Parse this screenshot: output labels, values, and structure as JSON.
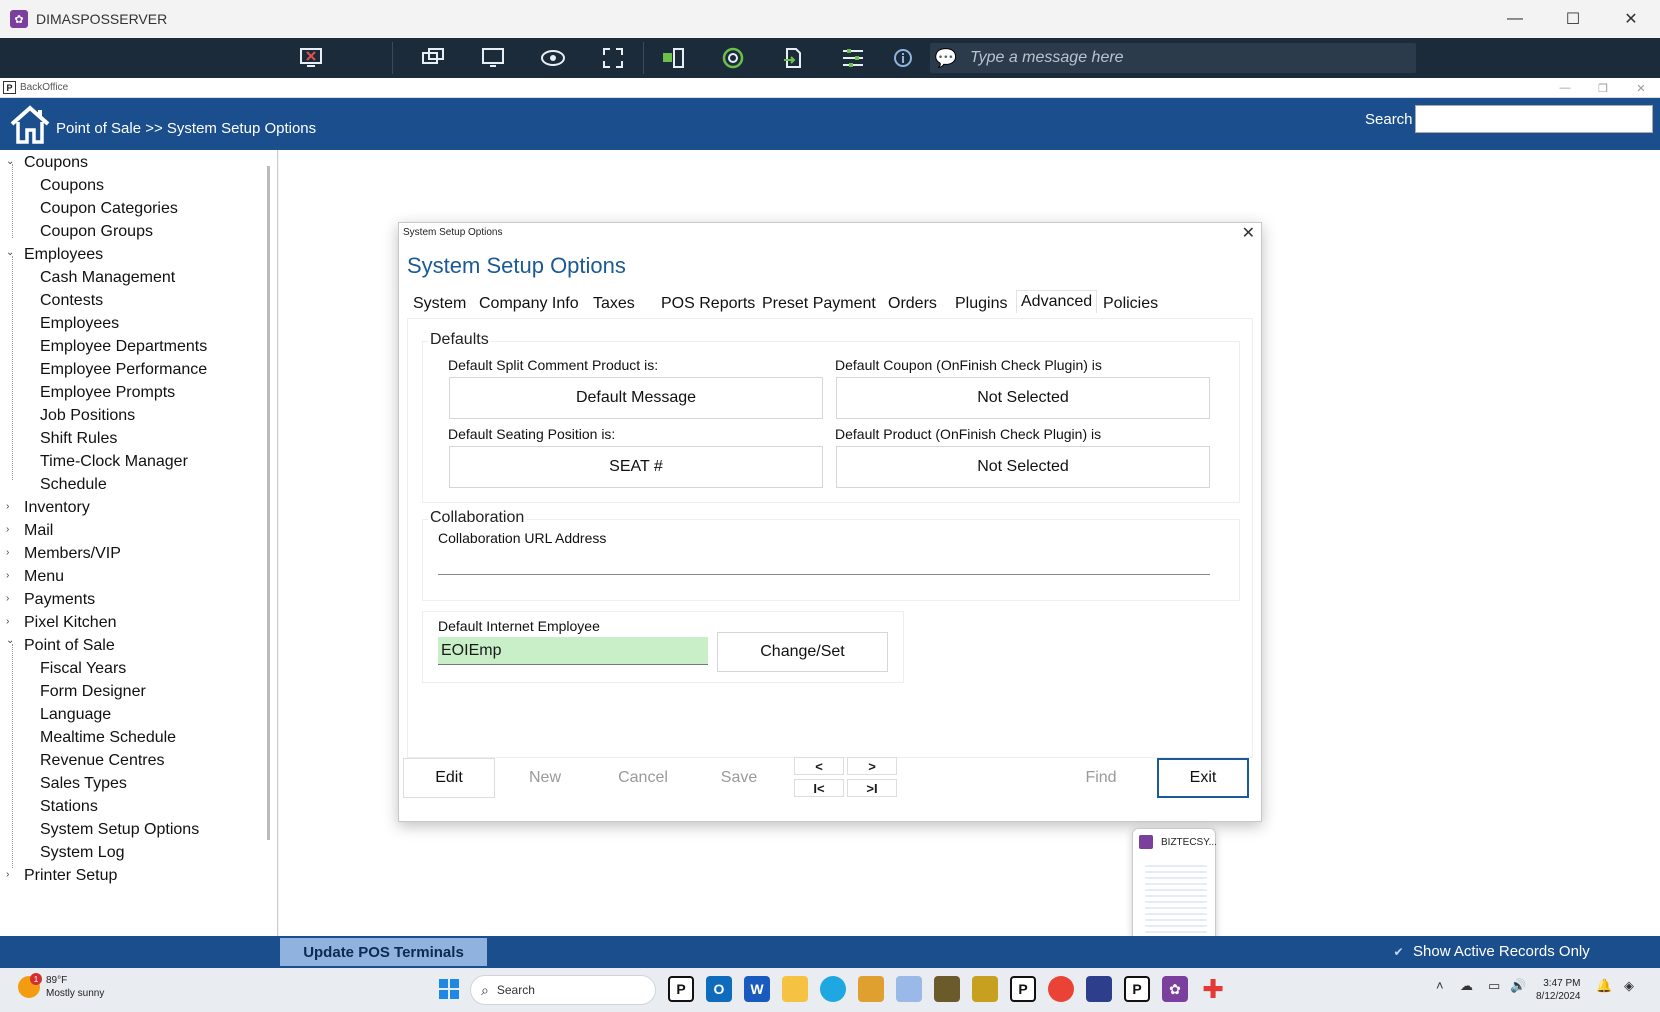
{
  "window": {
    "title": "DIMASPOSSERVER",
    "minimize": "—",
    "maximize": "☐",
    "close": "✕"
  },
  "remote_toolbar": {
    "message_placeholder": "Type a message here"
  },
  "backoffice": {
    "title": "BackOffice"
  },
  "header": {
    "breadcrumb": "Point of Sale >> System Setup Options",
    "search_label": "Search",
    "search_value": ""
  },
  "sidebar": {
    "items": [
      {
        "label": "Coupons",
        "level": 0,
        "expanded": true
      },
      {
        "label": "Coupons",
        "level": 1
      },
      {
        "label": "Coupon Categories",
        "level": 1
      },
      {
        "label": "Coupon Groups",
        "level": 1
      },
      {
        "label": "Employees",
        "level": 0,
        "expanded": true
      },
      {
        "label": "Cash Management",
        "level": 1
      },
      {
        "label": "Contests",
        "level": 1
      },
      {
        "label": "Employees",
        "level": 1
      },
      {
        "label": "Employee Departments",
        "level": 1
      },
      {
        "label": "Employee Performance",
        "level": 1
      },
      {
        "label": "Employee Prompts",
        "level": 1
      },
      {
        "label": "Job Positions",
        "level": 1
      },
      {
        "label": "Shift Rules",
        "level": 1
      },
      {
        "label": "Time-Clock Manager",
        "level": 1
      },
      {
        "label": "Schedule",
        "level": 1
      },
      {
        "label": "Inventory",
        "level": 0,
        "expanded": false
      },
      {
        "label": "Mail",
        "level": 0,
        "expanded": false
      },
      {
        "label": "Members/VIP",
        "level": 0,
        "expanded": false
      },
      {
        "label": "Menu",
        "level": 0,
        "expanded": false
      },
      {
        "label": "Payments",
        "level": 0,
        "expanded": false
      },
      {
        "label": "Pixel Kitchen",
        "level": 0,
        "expanded": false
      },
      {
        "label": "Point of Sale",
        "level": 0,
        "expanded": true
      },
      {
        "label": "Fiscal Years",
        "level": 1
      },
      {
        "label": "Form Designer",
        "level": 1
      },
      {
        "label": "Language",
        "level": 1
      },
      {
        "label": "Mealtime Schedule",
        "level": 1
      },
      {
        "label": "Revenue Centres",
        "level": 1
      },
      {
        "label": "Sales Types",
        "level": 1
      },
      {
        "label": "Stations",
        "level": 1
      },
      {
        "label": "System Setup Options",
        "level": 1
      },
      {
        "label": "System Log",
        "level": 1
      },
      {
        "label": "Printer Setup",
        "level": 0,
        "expanded": false
      }
    ]
  },
  "dialog": {
    "window_title": "System Setup Options",
    "heading": "System Setup Options",
    "tabs": [
      "System",
      "Company Info",
      "Taxes",
      "POS Reports",
      "Preset Payment",
      "Orders",
      "Plugins",
      "Advanced",
      "Policies"
    ],
    "active_tab": "Advanced",
    "defaults": {
      "group_label": "Defaults",
      "split_comment_label": "Default Split Comment Product is:",
      "split_comment_value": "Default Message",
      "coupon_label": "Default Coupon (OnFinish Check Plugin) is",
      "coupon_value": "Not Selected",
      "seating_label": "Default Seating Position is:",
      "seating_value": "SEAT #",
      "product_label": "Default Product (OnFinish Check Plugin) is",
      "product_value": "Not Selected"
    },
    "collaboration": {
      "group_label": "Collaboration",
      "url_label": "Collaboration URL Address",
      "url_value": ""
    },
    "internet_employee": {
      "label": "Default Internet Employee",
      "value": "EOIEmp",
      "button": "Change/Set"
    },
    "buttons": {
      "edit": "Edit",
      "new": "New",
      "cancel": "Cancel",
      "save": "Save",
      "prev": "<",
      "next": ">",
      "first": "I<",
      "last": ">I",
      "find": "Find",
      "exit": "Exit"
    }
  },
  "thumbnail": {
    "title": "BIZTECSY..."
  },
  "statusbar": {
    "update_button": "Update POS Terminals",
    "show_active_label": "Show Active Records Only",
    "show_active_checked": true
  },
  "taskbar": {
    "weather_badge": "1",
    "temperature": "89°F",
    "condition": "Mostly sunny",
    "search_label": "Search",
    "time": "3:47 PM",
    "date": "8/12/2024"
  },
  "colors": {
    "header_blue": "#1b4e8c",
    "heading_blue": "#1b5a96",
    "employee_field_green": "#c9efc9",
    "toolbar_dark": "#1c2b3a"
  }
}
